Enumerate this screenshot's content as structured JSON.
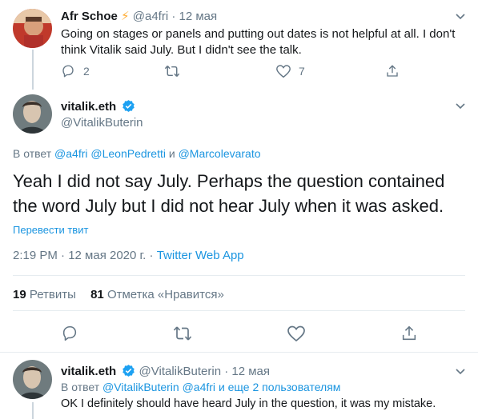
{
  "tweet1": {
    "name": "Afr Schoe",
    "emoji": "⚡",
    "handle": "@a4fri",
    "sep": "·",
    "date": "12 мая",
    "text_line1": "Going on stages or panels and putting out dates is not helpful at all. I don't",
    "text_line2": "think Vitalik said July. But I didn't see the talk.",
    "replies": "2",
    "likes": "7"
  },
  "main": {
    "name": "vitalik.eth",
    "handle": "@VitalikButerin",
    "reply_prefix": "В ответ",
    "reply_user1": "@a4fri",
    "reply_user2": "@LeonPedretti",
    "reply_and": "и",
    "reply_user3": "@Marcolevarato",
    "text_line1": "Yeah I did not say July. Perhaps the question contained",
    "text_line2": "the word July but I did not hear July when it was asked.",
    "translate": "Перевести твит",
    "time": "2:19 PM · 12 мая 2020 г.",
    "source_sep": "·",
    "source": "Twitter Web App",
    "retweets_count": "19",
    "retweets_label": "Ретвиты",
    "likes_count": "81",
    "likes_label": "Отметка «Нравится»"
  },
  "reply": {
    "name": "vitalik.eth",
    "handle": "@VitalikButerin",
    "sep": "·",
    "date": "12 мая",
    "reply_prefix": "В ответ",
    "reply_user1": "@VitalikButerin",
    "reply_user2": "@a4fri",
    "reply_rest": "и еще 2 пользователям",
    "text": "OK I definitely should have heard July in the question, it was my mistake."
  },
  "colors": {
    "accent": "#1b95e0",
    "secondary_text": "#657786",
    "primary_text": "#14171a",
    "divider": "#e6ecf0",
    "lightning": "#ffac33",
    "verified": "#1da1f2"
  },
  "icons": [
    "chevron-down-icon",
    "reply-icon",
    "retweet-icon",
    "like-icon",
    "share-icon",
    "verified-badge-icon",
    "lightning-emoji"
  ]
}
